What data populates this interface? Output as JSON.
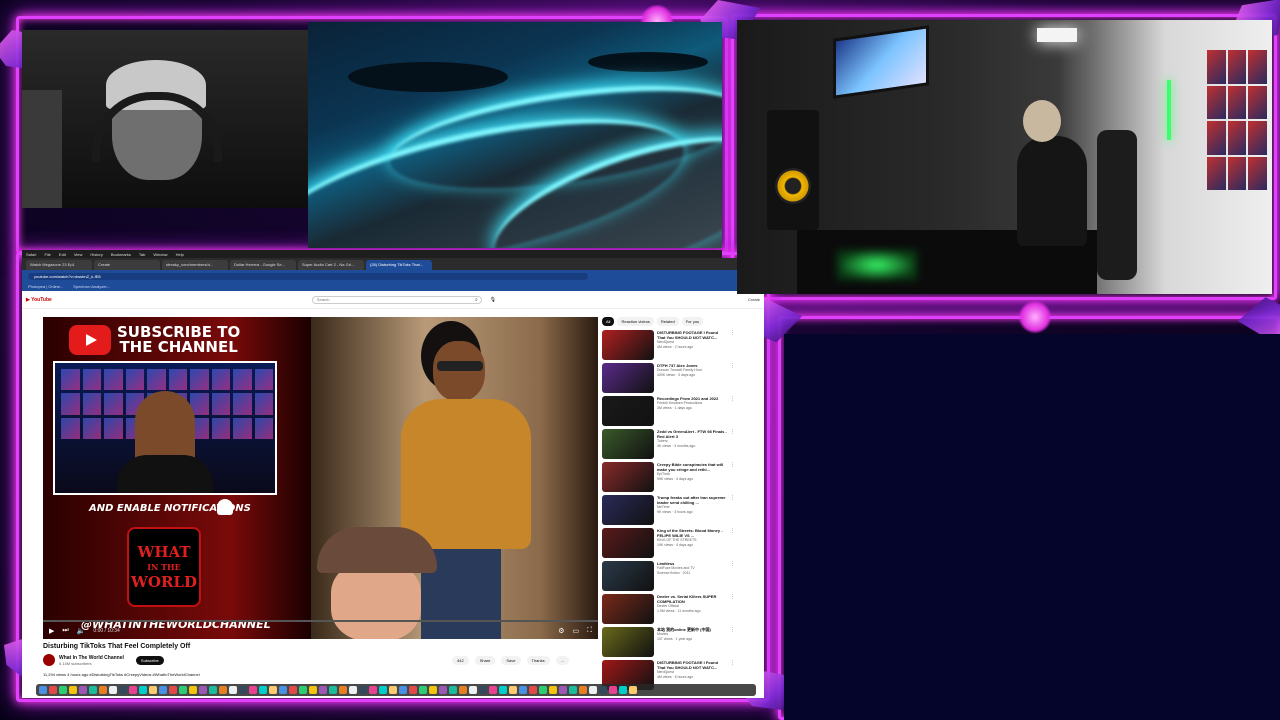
{
  "browser": {
    "tabs": [
      "Watch Megazone 23 Ep1",
      "Create",
      "streaky_com/members/d...",
      "Dollar Herrera - Google Se...",
      "Super Audio Cart 2 - Na Gri...",
      "(28) Disturbing TikToks That..."
    ],
    "active_tab": 5,
    "url": "youtube.com/watch?v=dwsbnZ_k-fE8",
    "bookmarks": [
      "Photopea | Online...",
      "Spectrum Analyzer..."
    ],
    "mac_menu": [
      "Safari",
      "File",
      "Edit",
      "View",
      "History",
      "Bookmarks",
      "Tab",
      "Window",
      "Help"
    ]
  },
  "youtube": {
    "search_placeholder": "Search",
    "create_label": "Create",
    "video": {
      "subscribe_line1": "SUBSCRIBE TO",
      "subscribe_line2": "THE CHANNEL",
      "notify_text": "AND ENABLE NOTIFICATIONS",
      "logo_line1": "WHAT",
      "logo_line2": "IN THE",
      "logo_line3": "WORLD",
      "handle": "@WHATINTHEWORLDCHANNEL",
      "time": "0:00 / 10:34"
    },
    "title": "Disturbing TikToks That Feel Completely Off",
    "channel_name": "What In The World Channel",
    "channel_subs": "5.14M subscribers",
    "subscribe_button": "Subscribe",
    "actions": [
      "442",
      "Share",
      "Save",
      "Thanks",
      "..."
    ],
    "meta": "11,294 views 4 hours ago #DisturbingTikToks #CreepyVideos #WhatInTheWorldChannel",
    "chips": [
      "All",
      "Reaction videos",
      "Related",
      "For you"
    ],
    "recommendations": [
      {
        "title": "DISTURBING FOOTAGE I Found That You SHOULD NOT WATC...",
        "channel": "NerdQuest",
        "stats": "4M views · 2 hours ago",
        "color": "#b02020"
      },
      {
        "title": "DTFH 737 Alex Jones",
        "channel": "Duncan Trussell Family Hour",
        "stats": "400K views · 3 days ago",
        "color": "#5a2a8a"
      },
      {
        "title": "Recordings From 2021 and 2022",
        "channel": "Fredrik Knudsen Productions",
        "stats": "3M views · 1 days ago",
        "color": "#1a1a1a"
      },
      {
        "title": "Zedd vs GreenAlert - FTW 98 Finals - Red Alert 3",
        "channel": "Tuberz",
        "stats": "4K views · 3 months ago",
        "color": "#3a5a2a"
      },
      {
        "title": "Creepy Bible conspiracies that will make you cringe and rethi...",
        "channel": "EpiTruth",
        "stats": "99K views · 4 days ago",
        "color": "#8a2a2a"
      },
      {
        "title": "Trump freaks out after Iran supreme leader send chilling ...",
        "channel": "MeTime",
        "stats": "9K views · 3 hours ago",
        "color": "#2a2a5a"
      },
      {
        "title": "King of the Streets: Blood Money - FELIPE WILIE VS ...",
        "channel": "KING OF THE STREETS",
        "stats": "19K views · 4 days ago",
        "color": "#5a1a1a"
      },
      {
        "title": "Limitless",
        "channel": "FailFuze Movies and TV",
        "stats": "Science fiction · 2011",
        "color": "#2a3a4a"
      },
      {
        "title": "Dexter vs. Serial Killers SUPER COMPILATION",
        "channel": "Dexter Official",
        "stats": "1.9M views · 11 months ago",
        "color": "#7a2a1a"
      },
      {
        "title": "本站 我的online 更新中 (中国)",
        "channel": "Movies",
        "stats": "107 views · 1 year ago",
        "color": "#6a6a1a"
      },
      {
        "title": "DISTURBING FOOTAGE I Found That You SHOULD NOT WATC...",
        "channel": "NerdQuest",
        "stats": "4M views · 6 hours ago",
        "color": "#a01818"
      }
    ]
  },
  "colors": {
    "neon_pink": "#e040ff",
    "youtube_red": "#e31b1b",
    "panel_bg": "#05042a"
  },
  "icons": {
    "search": "search-icon",
    "mic": "mic-icon",
    "play": "play-icon",
    "bell": "bell-icon",
    "more": "more-vertical-icon"
  }
}
